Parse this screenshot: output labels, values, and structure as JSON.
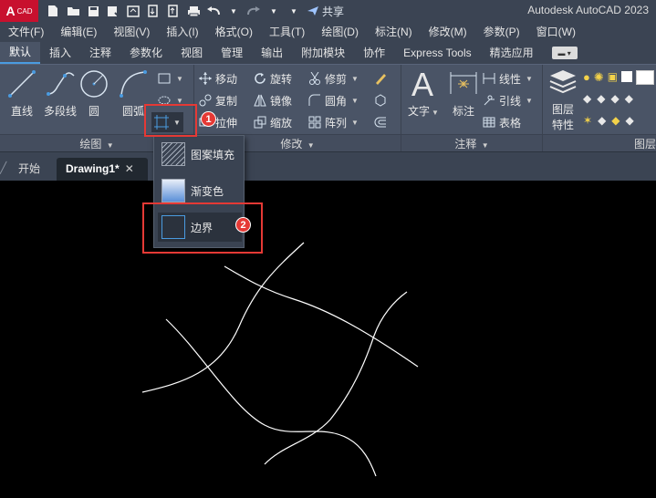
{
  "titlebar": {
    "app_button_letter": "A",
    "app_button_sub": "CAD",
    "share_label": "共享",
    "app_title": "Autodesk AutoCAD 2023",
    "quick_access_icons": [
      "new-icon",
      "open-icon",
      "save-icon",
      "save-as-icon",
      "cloud-icon",
      "import-icon",
      "export-icon",
      "print-icon",
      "undo-icon",
      "redo-icon",
      "dropdown-icon"
    ]
  },
  "menubar": {
    "items": [
      "文件(F)",
      "编辑(E)",
      "视图(V)",
      "插入(I)",
      "格式(O)",
      "工具(T)",
      "绘图(D)",
      "标注(N)",
      "修改(M)",
      "参数(P)",
      "窗口(W)"
    ]
  },
  "ribbon_tabs": {
    "items": [
      "默认",
      "插入",
      "注释",
      "参数化",
      "视图",
      "管理",
      "输出",
      "附加模块",
      "协作",
      "Express Tools",
      "精选应用"
    ],
    "active": "默认"
  },
  "ribbon": {
    "draw_panel": {
      "title": "绘图",
      "line": "直线",
      "polyline": "多段线",
      "circle": "圆",
      "arc": "圆弧"
    },
    "modify_panel": {
      "title": "修改",
      "move": "移动",
      "rotate": "旋转",
      "trim": "修剪",
      "copy": "复制",
      "mirror": "镜像",
      "fillet": "圆角",
      "stretch": "拉伸",
      "scale": "缩放",
      "array": "阵列"
    },
    "annotation_panel": {
      "title": "注释",
      "text": "文字",
      "dimension": "标注",
      "linear": "线性",
      "leader": "引线",
      "table": "表格"
    },
    "layers_panel": {
      "title": "图层",
      "layer_properties_line1": "图层",
      "layer_properties_line2": "特性"
    }
  },
  "doc_tabs": {
    "start": "开始",
    "drawing": "Drawing1*",
    "close": "✕"
  },
  "dropdown": {
    "items": [
      "图案填充",
      "渐变色",
      "边界"
    ]
  },
  "annotations": {
    "badge1": "1",
    "badge2": "2"
  },
  "colors": {
    "title_bg": "#3b4453",
    "ribbon_bg": "#4a5466",
    "canvas_bg": "#000000",
    "highlight": "#e53935",
    "accent": "#4a9be0"
  }
}
